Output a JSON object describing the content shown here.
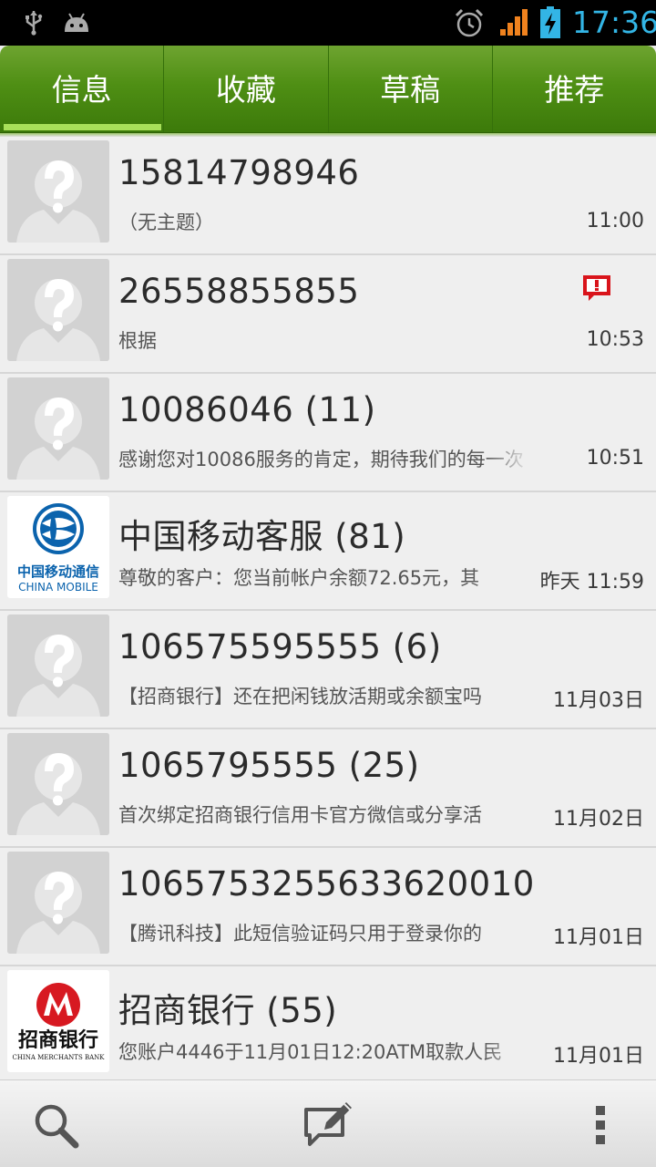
{
  "status_bar": {
    "time": "17:36",
    "icons": [
      "usb-icon",
      "android-debug-icon",
      "alarm-icon",
      "signal-icon",
      "battery-charging-icon"
    ],
    "accent_color": "#33b5e5"
  },
  "tabs": [
    {
      "label": "信息",
      "active": true
    },
    {
      "label": "收藏",
      "active": false
    },
    {
      "label": "草稿",
      "active": false
    },
    {
      "label": "推荐",
      "active": false
    }
  ],
  "colors": {
    "tab_green": "#4f8f14",
    "tab_indicator": "#a8e05a",
    "alert_red": "#d9141b"
  },
  "conversations": [
    {
      "name": "15814798946",
      "snippet": "（无主题）",
      "time": "11:00",
      "avatar": "unknown-contact-icon"
    },
    {
      "name": "26558855855",
      "snippet": "根据",
      "time": "10:53",
      "avatar": "unknown-contact-icon",
      "alert": "send-failed-icon"
    },
    {
      "name": "10086046 (11)",
      "snippet": "感谢您对10086服务的肯定，期待我们的每一次",
      "time": "10:51",
      "avatar": "unknown-contact-icon"
    },
    {
      "name": "中国移动客服 (81)",
      "snippet": "尊敬的客户：您当前帐户余额72.65元，其",
      "time": "昨天 11:59",
      "avatar": "china-mobile-logo",
      "logo_text_cn": "中国移动通信",
      "logo_text_en": "CHINA MOBILE"
    },
    {
      "name": "106575595555 (6)",
      "snippet": "【招商银行】还在把闲钱放活期或余额宝吗",
      "time": "11月03日",
      "avatar": "unknown-contact-icon"
    },
    {
      "name": "1065795555 (25)",
      "snippet": "首次绑定招商银行信用卡官方微信或分享活",
      "time": "11月02日",
      "avatar": "unknown-contact-icon"
    },
    {
      "name": "1065753255633620010",
      "snippet": "【腾讯科技】此短信验证码只用于登录你的",
      "time": "11月01日",
      "avatar": "unknown-contact-icon"
    },
    {
      "name": "招商银行 (55)",
      "snippet": "您账户4446于11月01日12:20ATM取款人民",
      "time": "11月01日",
      "avatar": "cmb-logo",
      "logo_text_cn": "招商银行",
      "logo_text_en": "CHINA MERCHANTS BANK"
    }
  ],
  "bottom_bar": {
    "icons": [
      "search-icon",
      "compose-icon",
      "overflow-menu-icon"
    ]
  }
}
